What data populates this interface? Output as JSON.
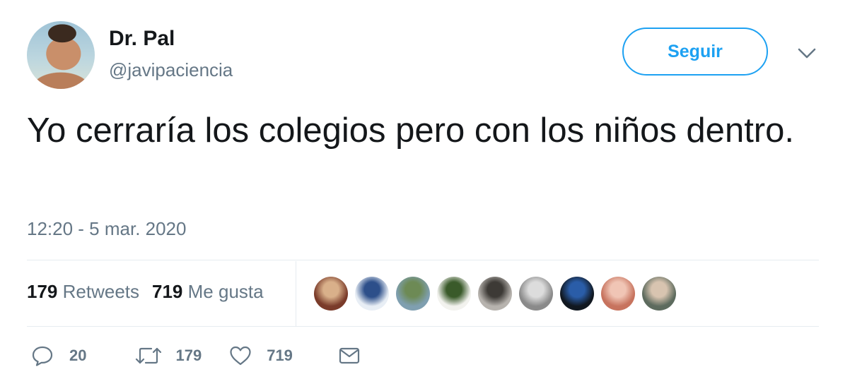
{
  "author": {
    "display_name": "Dr. Pal",
    "handle": "@javipaciencia"
  },
  "follow_button_label": "Seguir",
  "tweet": {
    "text": "Yo cerraría los colegios pero con los niños dentro.",
    "timestamp": "12:20 - 5 mar. 2020"
  },
  "stats": {
    "retweets_count": "179",
    "retweets_label": "Retweets",
    "likes_count": "719",
    "likes_label": "Me gusta"
  },
  "likers": [
    {
      "colors": [
        "#7a3b2a",
        "#d9b08a"
      ]
    },
    {
      "colors": [
        "#e8eef5",
        "#2d4f8a"
      ]
    },
    {
      "colors": [
        "#7f9fb0",
        "#6d8a55"
      ]
    },
    {
      "colors": [
        "#f2f2ee",
        "#3a5a2a"
      ]
    },
    {
      "colors": [
        "#b7b3ae",
        "#3d3a36"
      ]
    },
    {
      "colors": [
        "#8a8a8a",
        "#dcdcdc"
      ]
    },
    {
      "colors": [
        "#111820",
        "#2a5da8"
      ]
    },
    {
      "colors": [
        "#c7735e",
        "#f0c5b5"
      ]
    },
    {
      "colors": [
        "#5d6b5e",
        "#d8c4b0"
      ]
    }
  ],
  "actions": {
    "reply_count": "20",
    "retweet_count": "179",
    "like_count": "719"
  },
  "icons": {
    "reply": "reply-icon",
    "retweet": "retweet-icon",
    "like": "heart-icon",
    "dm": "envelope-icon",
    "caret": "chevron-down-icon"
  },
  "colors": {
    "accent": "#1da1f2",
    "secondary_text": "#657786",
    "primary_text": "#14171a",
    "divider": "#e6ecf0"
  }
}
